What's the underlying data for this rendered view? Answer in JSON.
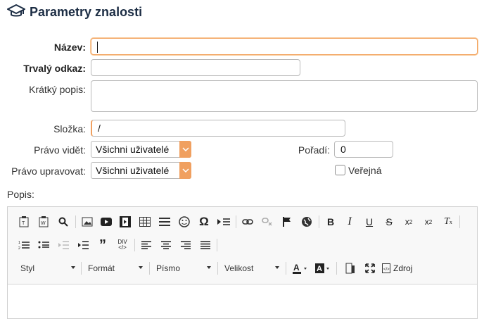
{
  "header": {
    "title": "Parametry znalosti",
    "icon": "graduation-cap-icon"
  },
  "form": {
    "nazev": {
      "label": "Název:",
      "value": ""
    },
    "odkaz": {
      "label": "Trvalý odkaz:",
      "value": ""
    },
    "popis_kratky": {
      "label": "Krátký popis:",
      "value": ""
    },
    "slozka": {
      "label": "Složka:",
      "value": "/"
    },
    "pravo_videt": {
      "label": "Právo vidět:",
      "value": "Všichni uživatelé"
    },
    "poradi": {
      "label": "Pořadí:",
      "value": "0"
    },
    "pravo_upravovat": {
      "label": "Právo upravovat:",
      "value": "Všichni uživatelé"
    },
    "verejna": {
      "label": "Veřejná",
      "checked": false
    },
    "popis": {
      "label": "Popis:"
    }
  },
  "editor": {
    "combos": [
      "Styl",
      "Formát",
      "Písmo",
      "Velikost"
    ],
    "source_label": "Zdroj",
    "accent_color": "#f0a060"
  }
}
